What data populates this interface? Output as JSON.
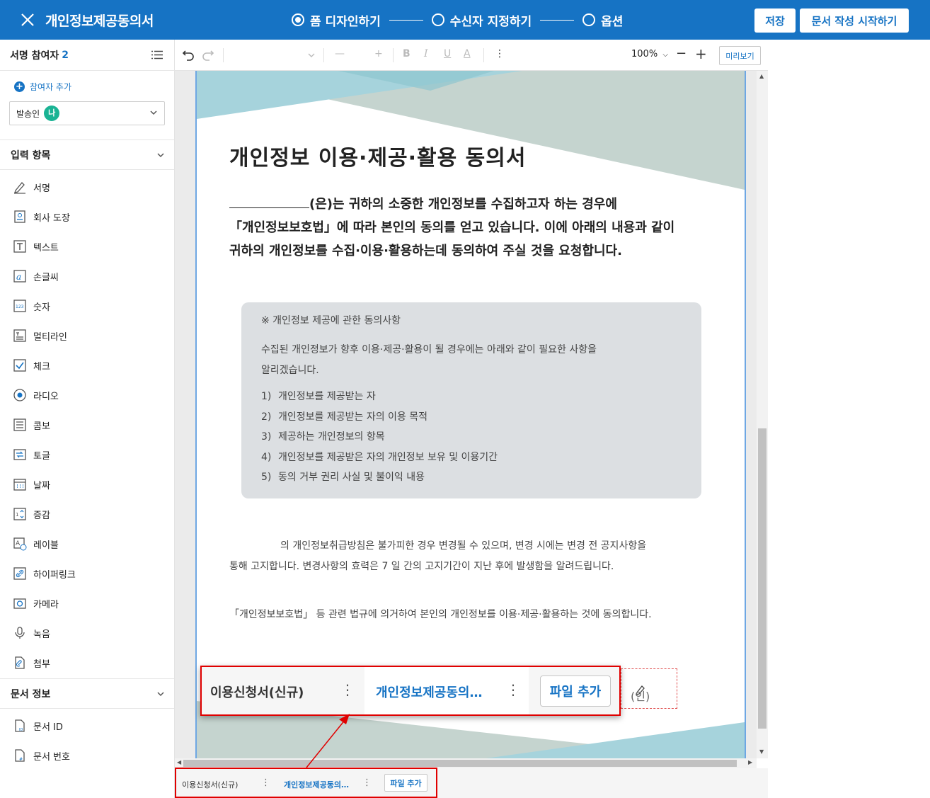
{
  "header": {
    "title": "개인정보제공동의서",
    "steps": [
      {
        "label": "폼 디자인하기",
        "active": true
      },
      {
        "label": "수신자 지정하기",
        "active": false
      },
      {
        "label": "옵션",
        "active": false
      }
    ],
    "save_label": "저장",
    "start_label": "문서 작성 시작하기",
    "color": "#1673c4"
  },
  "sidebar": {
    "participants_label": "서명 참여자",
    "participants_count": "2",
    "add_participant": "참여자 추가",
    "sender_label": "발송인",
    "sender_badge": "나",
    "input_section": "입력 항목",
    "fields": [
      {
        "label": "서명",
        "icon": "pen-icon"
      },
      {
        "label": "회사 도장",
        "icon": "stamp-icon"
      },
      {
        "label": "텍스트",
        "icon": "text-icon"
      },
      {
        "label": "손글씨",
        "icon": "handwriting-icon"
      },
      {
        "label": "숫자",
        "icon": "number-icon"
      },
      {
        "label": "멀티라인",
        "icon": "multiline-icon"
      },
      {
        "label": "체크",
        "icon": "checkbox-icon"
      },
      {
        "label": "라디오",
        "icon": "radio-icon"
      },
      {
        "label": "콤보",
        "icon": "combo-icon"
      },
      {
        "label": "토글",
        "icon": "toggle-icon"
      },
      {
        "label": "날짜",
        "icon": "calendar-icon"
      },
      {
        "label": "증감",
        "icon": "stepper-icon"
      },
      {
        "label": "레이블",
        "icon": "label-icon"
      },
      {
        "label": "하이퍼링크",
        "icon": "link-icon"
      },
      {
        "label": "카메라",
        "icon": "camera-icon"
      },
      {
        "label": "녹음",
        "icon": "microphone-icon"
      },
      {
        "label": "첨부",
        "icon": "attachment-icon"
      }
    ],
    "doc_info_section": "문서 정보",
    "doc_fields": [
      {
        "label": "문서 ID",
        "icon": "doc-id-icon"
      },
      {
        "label": "문서 번호",
        "icon": "doc-number-icon"
      }
    ]
  },
  "toolbar": {
    "zoom": "100%",
    "preview": "미리보기"
  },
  "document": {
    "title": "개인정보 이용·제공·활용 동의서",
    "intro_line1": "(은)는 귀하의 소중한 개인정보를 수집하고자 하는 경우에",
    "intro_line2": "「개인정보보호법」에 따라 본인의 동의를 얻고 있습니다. 이에 아래의 내용과 같이",
    "intro_line3": "귀하의 개인정보를 수집·이용·활용하는데 동의하여 주실 것을 요청합니다.",
    "notice_title": "※ 개인정보 제공에 관한 동의사항",
    "notice_body_1": "수집된 개인정보가 향후 이용·제공·활용이 될 경우에는 아래와 같이 필요한 사항을",
    "notice_body_2": "알리겠습니다.",
    "notice_items": [
      {
        "num": "1)",
        "text": "개인정보를 제공받는 자"
      },
      {
        "num": "2)",
        "text": "개인정보를 제공받는 자의 이용 목적"
      },
      {
        "num": "3)",
        "text": "제공하는 개인정보의 항목"
      },
      {
        "num": "4)",
        "text": "개인정보를 제공받은 자의 개인정보 보유 및 이용기간"
      },
      {
        "num": "5)",
        "text": "동의 거부 권리 사실 및 불이익 내용"
      }
    ],
    "policy_line1": "의 개인정보취급방침은 불가피한 경우 변경될 수 있으며, 변경 시에는 변경 전 공지사항을",
    "policy_line2": "통해 고지합니다. 변경사항의 효력은 7 일 간의 고지기간이 지난 후에 발생함을 알려드립니다.",
    "consent_line": "「개인정보보호법」 등 관련 법규에 의거하여 본인의 개인정보를 이용·제공·활용하는 것에 동의합니다.",
    "seal_label": "(인)"
  },
  "doc_tabs": {
    "tab_a": "이용신청서(신규)",
    "tab_b": "개인정보제공동의…",
    "file_add": "파일 추가",
    "dots": "⋮"
  }
}
